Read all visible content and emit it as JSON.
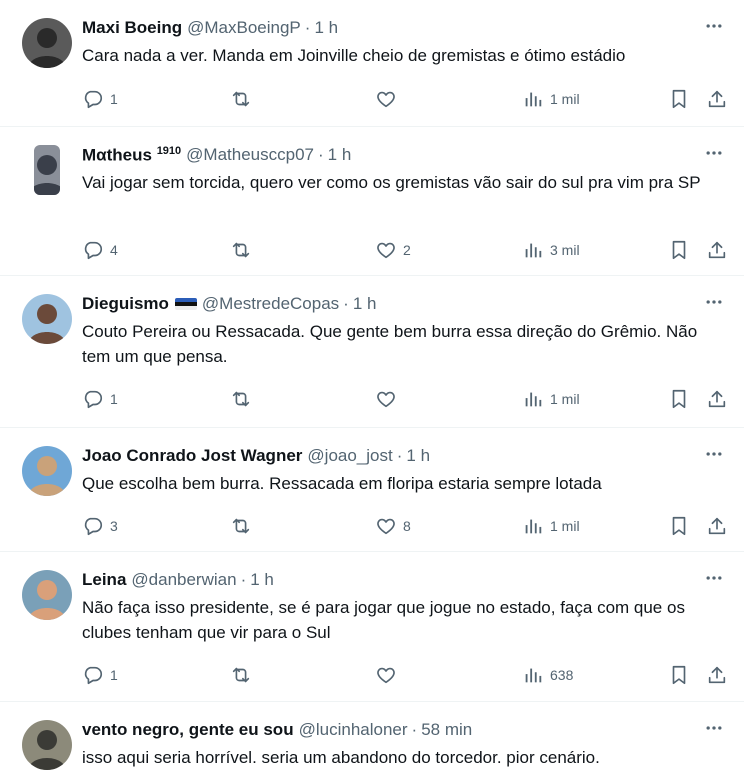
{
  "tweets": [
    {
      "name": "Maxi Boeing",
      "name_suffix": "",
      "has_flag": false,
      "handle": "@MaxBoeingP",
      "time": "1 h",
      "text": "Cara nada a ver. Manda em Joinville cheio de gremistas e ótimo estádio",
      "replies": "1",
      "reposts": "",
      "likes": "",
      "views": "1 mil",
      "avatar_colors": [
        "#2a2a2a",
        "#5a5a5a"
      ]
    },
    {
      "name": "Mαtheus",
      "name_suffix": "1910",
      "has_flag": false,
      "handle": "@Matheusccp07",
      "time": "1 h",
      "text": "Vai jogar sem torcida, quero ver como os gremistas vão sair do sul pra vim pra SP",
      "replies": "4",
      "reposts": "",
      "likes": "2",
      "views": "3 mil",
      "avatar_colors": [
        "#3a3f4a",
        "#8a8f99"
      ]
    },
    {
      "name": "Dieguismo",
      "name_suffix": "",
      "has_flag": true,
      "handle": "@MestredeCopas",
      "time": "1 h",
      "text": "Couto Pereira ou Ressacada. Que gente bem burra essa direção do Grêmio. Não tem um que pensa.",
      "replies": "1",
      "reposts": "",
      "likes": "",
      "views": "1 mil",
      "avatar_colors": [
        "#6b4a3a",
        "#9fc3e0"
      ]
    },
    {
      "name": "Joao Conrado Jost Wagner",
      "name_suffix": "",
      "has_flag": false,
      "handle": "@joao_jost",
      "time": "1 h",
      "text": "Que escolha bem burra. Ressacada em floripa estaria sempre lotada",
      "replies": "3",
      "reposts": "",
      "likes": "8",
      "views": "1 mil",
      "avatar_colors": [
        "#c9a27a",
        "#6fa7d6"
      ]
    },
    {
      "name": "Leina",
      "name_suffix": "",
      "has_flag": false,
      "handle": "@danberwian",
      "time": "1 h",
      "text": "Não faça isso presidente, se é para jogar que jogue no estado, faça com que os clubes tenham que vir para o Sul",
      "replies": "1",
      "reposts": "",
      "likes": "",
      "views": "638",
      "avatar_colors": [
        "#d9a07a",
        "#7aa0b8"
      ]
    },
    {
      "name": "vento negro, gente eu sou",
      "name_suffix": "",
      "has_flag": false,
      "handle": "@lucinhaloner",
      "time": "58 min",
      "text": "isso aqui seria horrível. seria um abandono do torcedor. pior cenário.",
      "replies": "",
      "reposts": "",
      "likes": "",
      "views": "",
      "avatar_colors": [
        "#3b3b36",
        "#8c8a7a"
      ]
    }
  ],
  "separator": "·",
  "icons": {
    "more": "more-icon",
    "reply": "reply-icon",
    "repost": "repost-icon",
    "like": "like-icon",
    "views": "views-icon",
    "bookmark": "bookmark-icon",
    "share": "share-icon"
  },
  "colors": {
    "text": "#0f1419",
    "secondary": "#536471",
    "divider": "#eff3f4"
  }
}
